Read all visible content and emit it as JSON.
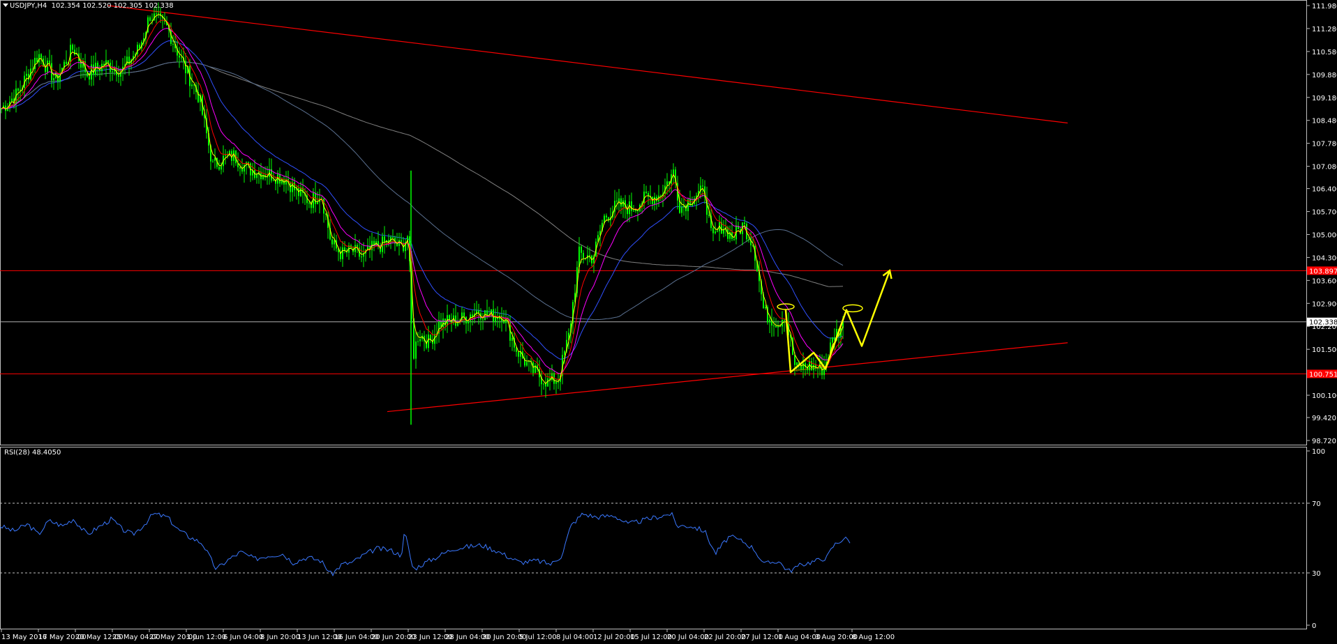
{
  "header": {
    "symbol": "USDJPY,H4",
    "ohlc": "102.354 102.520 102.305 102.338"
  },
  "rsi_header": "RSI(28) 48.4050",
  "colors": {
    "background": "#000000",
    "candles": "#00ff00",
    "trendlines": "#ff0000",
    "ma_fast": "#ffff00",
    "ma_red": "#ff0000",
    "ma_magenta": "#ff00ff",
    "ma_blue": "#3050ff",
    "ma_slate": "#5a7090",
    "ma_grey": "#808080",
    "rsi": "#3a78ff",
    "projection": "#ffff00"
  },
  "chart_data": [
    {
      "type": "line",
      "symbol": "USDJPY",
      "timeframe": "H4",
      "price_axis": {
        "min": 98.72,
        "max": 111.98,
        "ticks": [
          "111.980",
          "111.280",
          "110.580",
          "109.880",
          "109.180",
          "108.480",
          "107.780",
          "107.080",
          "106.400",
          "105.700",
          "105.000",
          "104.300",
          "103.600",
          "102.900",
          "102.200",
          "101.500",
          "100.800",
          "100.100",
          "99.420",
          "98.720"
        ]
      },
      "time_axis": [
        "13 May 2016",
        "17 May 20:00",
        "20 May 12:00",
        "25 May 04:00",
        "27 May 20:00",
        "1 Jun 12:00",
        "6 Jun 04:00",
        "8 Jun 20:00",
        "13 Jun 12:00",
        "16 Jun 04:00",
        "20 Jun 20:00",
        "23 Jun 12:00",
        "28 Jun 04:00",
        "30 Jun 20:00",
        "5 Jul 12:00",
        "8 Jul 04:00",
        "12 Jul 20:00",
        "15 Jul 12:00",
        "20 Jul 04:00",
        "22 Jul 20:00",
        "27 Jul 12:00",
        "1 Aug 04:00",
        "3 Aug 20:00",
        "8 Aug 12:00"
      ],
      "price_labels": {
        "upper_level": "103.897",
        "current": "102.338",
        "lower_level": "100.751"
      },
      "horizontal_levels": [
        103.897,
        102.338,
        100.751
      ],
      "close_path": [
        [
          0,
          108.8
        ],
        [
          25,
          109.3
        ],
        [
          55,
          110.5
        ],
        [
          80,
          109.7
        ],
        [
          105,
          110.7
        ],
        [
          125,
          109.9
        ],
        [
          150,
          110.2
        ],
        [
          175,
          110.0
        ],
        [
          200,
          110.7
        ],
        [
          215,
          111.7
        ],
        [
          240,
          111.3
        ],
        [
          260,
          110.3
        ],
        [
          285,
          109.2
        ],
        [
          305,
          107.1
        ],
        [
          320,
          107.3
        ],
        [
          335,
          107.4
        ],
        [
          355,
          107.0
        ],
        [
          375,
          106.9
        ],
        [
          395,
          106.8
        ],
        [
          410,
          106.7
        ],
        [
          425,
          106.3
        ],
        [
          445,
          106.0
        ],
        [
          460,
          106.3
        ],
        [
          475,
          104.7
        ],
        [
          490,
          104.4
        ],
        [
          505,
          104.5
        ],
        [
          520,
          104.3
        ],
        [
          535,
          104.6
        ],
        [
          560,
          104.8
        ],
        [
          575,
          104.6
        ],
        [
          585,
          105.0
        ],
        [
          592,
          101.3
        ],
        [
          600,
          102.0
        ],
        [
          615,
          101.7
        ],
        [
          630,
          102.3
        ],
        [
          660,
          102.4
        ],
        [
          685,
          102.7
        ],
        [
          700,
          102.5
        ],
        [
          720,
          102.6
        ],
        [
          740,
          101.5
        ],
        [
          760,
          100.9
        ],
        [
          785,
          100.5
        ],
        [
          800,
          100.6
        ],
        [
          815,
          101.9
        ],
        [
          830,
          104.4
        ],
        [
          850,
          104.3
        ],
        [
          865,
          105.5
        ],
        [
          885,
          105.9
        ],
        [
          905,
          105.8
        ],
        [
          925,
          106.1
        ],
        [
          945,
          106.2
        ],
        [
          965,
          106.9
        ],
        [
          975,
          105.8
        ],
        [
          995,
          106.2
        ],
        [
          1010,
          106.3
        ],
        [
          1020,
          104.8
        ],
        [
          1035,
          105.3
        ],
        [
          1050,
          104.9
        ],
        [
          1065,
          105.3
        ],
        [
          1080,
          104.7
        ],
        [
          1095,
          102.6
        ],
        [
          1115,
          102.3
        ],
        [
          1125,
          102.6
        ],
        [
          1140,
          100.9
        ],
        [
          1160,
          101.0
        ],
        [
          1180,
          100.9
        ],
        [
          1195,
          101.9
        ],
        [
          1210,
          102.3
        ]
      ],
      "annotations": {
        "projection_zigzag": [
          [
            1126,
            102.7
          ],
          [
            1133,
            100.8
          ],
          [
            1166,
            101.4
          ],
          [
            1183,
            100.9
          ],
          [
            1213,
            102.7
          ],
          [
            1235,
            101.6
          ],
          [
            1275,
            103.9
          ]
        ],
        "channel_top_line": [
          [
            155,
            111.98
          ],
          [
            1530,
            108.4
          ]
        ],
        "channel_bottom_line": [
          [
            555,
            99.6
          ],
          [
            1530,
            101.7
          ]
        ]
      }
    },
    {
      "type": "line",
      "indicator": "RSI",
      "period": 28,
      "value": 48.405,
      "y_ticks": [
        "100",
        "70",
        "30",
        "0"
      ],
      "levels": [
        70,
        30
      ],
      "values": [
        [
          0,
          57
        ],
        [
          20,
          54
        ],
        [
          40,
          58
        ],
        [
          55,
          52
        ],
        [
          70,
          60
        ],
        [
          90,
          57
        ],
        [
          105,
          61
        ],
        [
          125,
          52
        ],
        [
          140,
          56
        ],
        [
          160,
          61
        ],
        [
          175,
          55
        ],
        [
          190,
          52
        ],
        [
          205,
          57
        ],
        [
          220,
          64
        ],
        [
          240,
          62
        ],
        [
          255,
          55
        ],
        [
          270,
          51
        ],
        [
          290,
          47
        ],
        [
          310,
          32
        ],
        [
          325,
          37
        ],
        [
          345,
          42
        ],
        [
          365,
          38
        ],
        [
          385,
          40
        ],
        [
          405,
          41
        ],
        [
          420,
          36
        ],
        [
          440,
          39
        ],
        [
          460,
          37
        ],
        [
          475,
          29
        ],
        [
          490,
          35
        ],
        [
          505,
          36
        ],
        [
          520,
          40
        ],
        [
          540,
          44
        ],
        [
          560,
          43
        ],
        [
          575,
          40
        ],
        [
          580,
          54
        ],
        [
          592,
          32
        ],
        [
          610,
          36
        ],
        [
          630,
          40
        ],
        [
          650,
          44
        ],
        [
          670,
          45
        ],
        [
          690,
          46
        ],
        [
          710,
          43
        ],
        [
          730,
          39
        ],
        [
          745,
          36
        ],
        [
          770,
          37
        ],
        [
          790,
          35
        ],
        [
          805,
          40
        ],
        [
          818,
          57
        ],
        [
          835,
          64
        ],
        [
          855,
          62
        ],
        [
          880,
          63
        ],
        [
          900,
          58
        ],
        [
          920,
          60
        ],
        [
          940,
          62
        ],
        [
          962,
          64
        ],
        [
          970,
          57
        ],
        [
          990,
          57
        ],
        [
          1010,
          54
        ],
        [
          1025,
          41
        ],
        [
          1045,
          51
        ],
        [
          1065,
          48
        ],
        [
          1080,
          44
        ],
        [
          1095,
          35
        ],
        [
          1115,
          37
        ],
        [
          1130,
          31
        ],
        [
          1150,
          35
        ],
        [
          1170,
          37
        ],
        [
          1185,
          39
        ],
        [
          1195,
          46
        ],
        [
          1210,
          50
        ],
        [
          1220,
          48
        ]
      ]
    }
  ]
}
